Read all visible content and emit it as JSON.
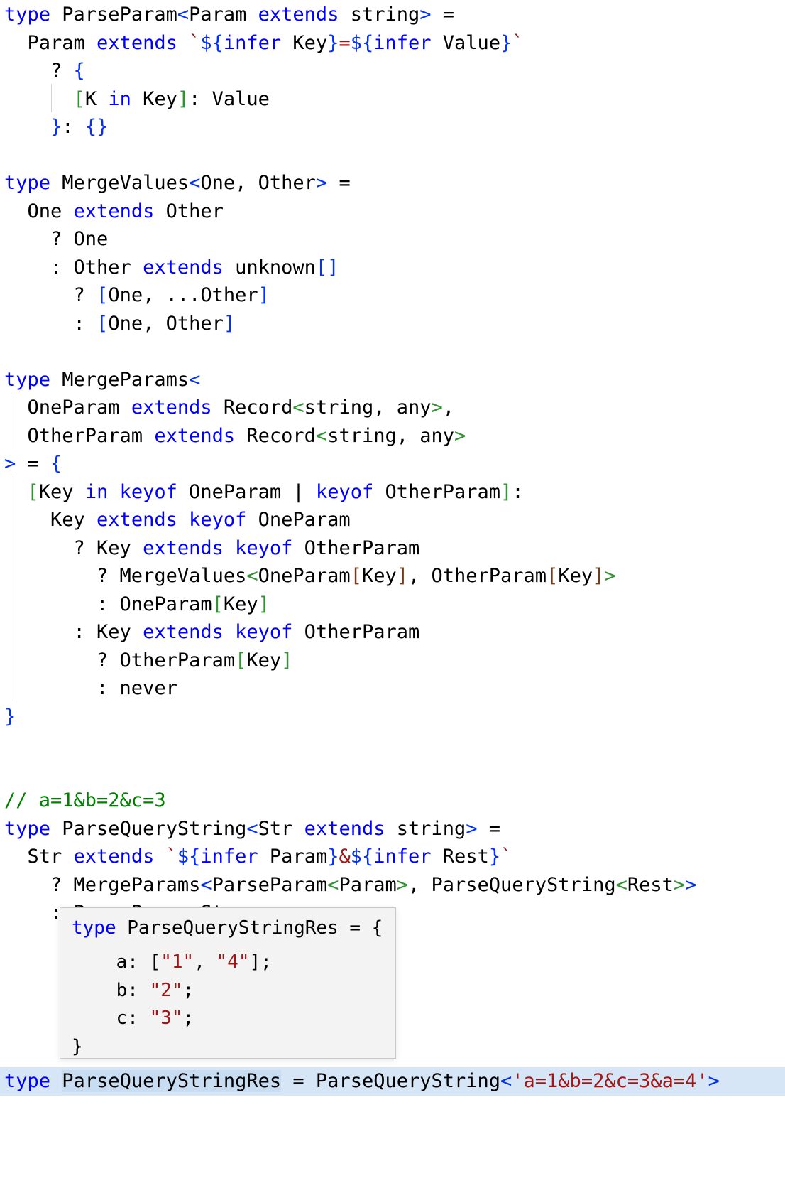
{
  "editor": {
    "language": "typescript",
    "background": "#ffffff",
    "foreground": "#000000",
    "current_line_highlight": "#d7e6f7",
    "colors": {
      "keyword": "#0000ff",
      "identifier": "#000000",
      "string": "#a31515",
      "comment": "#008000",
      "bracket_level_1": "#0431fa",
      "bracket_level_2": "#319331",
      "bracket_level_3": "#7b3814",
      "indent_guide": "#d3d3d3",
      "word_highlight": "#c8ddf2"
    }
  },
  "code": {
    "l01": {
      "t1": "type",
      "t2": " ParseParam",
      "t3": "<",
      "t4": "Param ",
      "t5": "extends",
      "t6": " string",
      "t7": ">",
      "t8": " ="
    },
    "l02": {
      "t1": "  Param ",
      "t2": "extends",
      "t3": " ",
      "t4": "`",
      "t5": "${",
      "t6": "infer",
      "t7": " Key",
      "t8": "}",
      "t9": "=",
      "t10": "${",
      "t11": "infer",
      "t12": " Value",
      "t13": "}",
      "t14": "`"
    },
    "l03": {
      "t1": "    ? ",
      "t2": "{"
    },
    "l04": {
      "t1": "      ",
      "t2": "[",
      "t3": "K ",
      "t4": "in",
      "t5": " Key",
      "t6": "]",
      "t7": ": Value"
    },
    "l05": {
      "t1": "    ",
      "t2": "}",
      "t3": ": ",
      "t4": "{}"
    },
    "l06": "",
    "l07": {
      "t1": "type",
      "t2": " MergeValues",
      "t3": "<",
      "t4": "One, Other",
      "t5": ">",
      "t6": " ="
    },
    "l08": {
      "t1": "  One ",
      "t2": "extends",
      "t3": " Other"
    },
    "l09": {
      "t1": "    ? One"
    },
    "l10": {
      "t1": "    : Other ",
      "t2": "extends",
      "t3": " unknown",
      "t4": "[]"
    },
    "l11": {
      "t1": "      ? ",
      "t2": "[",
      "t3": "One, ...Other",
      "t4": "]"
    },
    "l12": {
      "t1": "      : ",
      "t2": "[",
      "t3": "One, Other",
      "t4": "]"
    },
    "l13": "",
    "l14": {
      "t1": "type",
      "t2": " MergeParams",
      "t3": "<"
    },
    "l15": {
      "t1": "  OneParam ",
      "t2": "extends",
      "t3": " Record",
      "t4": "<",
      "t5": "string, any",
      "t6": ">",
      "t7": ","
    },
    "l16": {
      "t1": "  OtherParam ",
      "t2": "extends",
      "t3": " Record",
      "t4": "<",
      "t5": "string, any",
      "t6": ">"
    },
    "l17": {
      "t1": ">",
      "t2": " = ",
      "t3": "{"
    },
    "l18": {
      "t1": "  ",
      "t2": "[",
      "t3": "Key ",
      "t4": "in",
      "t5": " ",
      "t6": "keyof",
      "t7": " OneParam | ",
      "t8": "keyof",
      "t9": " OtherParam",
      "t10": "]",
      "t11": ":"
    },
    "l19": {
      "t1": "    Key ",
      "t2": "extends",
      "t3": " ",
      "t4": "keyof",
      "t5": " OneParam"
    },
    "l20": {
      "t1": "      ? Key ",
      "t2": "extends",
      "t3": " ",
      "t4": "keyof",
      "t5": " OtherParam"
    },
    "l21": {
      "t1": "        ? MergeValues",
      "t2": "<",
      "t3": "OneParam",
      "t4": "[",
      "t5": "Key",
      "t6": "]",
      "t7": ", OtherParam",
      "t8": "[",
      "t9": "Key",
      "t10": "]",
      "t11": ">"
    },
    "l22": {
      "t1": "        : OneParam",
      "t2": "[",
      "t3": "Key",
      "t4": "]"
    },
    "l23": {
      "t1": "      : Key ",
      "t2": "extends",
      "t3": " ",
      "t4": "keyof",
      "t5": " OtherParam"
    },
    "l24": {
      "t1": "        ? OtherParam",
      "t2": "[",
      "t3": "Key",
      "t4": "]"
    },
    "l25": {
      "t1": "        : never"
    },
    "l26": {
      "t1": "}"
    },
    "l27": "",
    "l28": "",
    "l29": {
      "t1": "// a=1&b=2&c=3"
    },
    "l30": {
      "t1": "type",
      "t2": " ParseQueryString",
      "t3": "<",
      "t4": "Str ",
      "t5": "extends",
      "t6": " string",
      "t7": ">",
      "t8": " ="
    },
    "l31": {
      "t1": "  Str ",
      "t2": "extends",
      "t3": " ",
      "t4": "`",
      "t5": "${",
      "t6": "infer",
      "t7": " Param",
      "t8": "}",
      "t9": "&",
      "t10": "${",
      "t11": "infer",
      "t12": " Rest",
      "t13": "}",
      "t14": "`"
    },
    "l32": {
      "t1": "    ? MergeParams",
      "t2": "<",
      "t3": "ParseParam",
      "t4": "<",
      "t5": "Param",
      "t6": ">",
      "t7": ", ParseQueryString",
      "t8": "<",
      "t9": "Rest",
      "t10": ">",
      "t11": ">"
    },
    "l33": {
      "t1": "    : ParseParam",
      "t2": "<",
      "t3": "Str",
      "t4": ">"
    },
    "l34": "",
    "l35": "",
    "l36": "",
    "l37": "",
    "l38": "",
    "l39": {
      "t1": "type",
      "t2": " ",
      "t3": "ParseQueryStringRes",
      "t4": " = ParseQueryString",
      "t5": "<",
      "t6": "'a=1&b=2&c=3&a=4'",
      "t7": ">"
    }
  },
  "hover_tooltip": {
    "visible": true,
    "background": "#f3f3f3",
    "border_color": "#c8c8c8",
    "lines": {
      "h1": {
        "t1": "type",
        "t2": " ParseQueryStringRes = {"
      },
      "h2": {
        "t1": "    a: [",
        "t2": "\"1\"",
        "t3": ", ",
        "t4": "\"4\"",
        "t5": "];"
      },
      "h3": {
        "t1": "    b: ",
        "t2": "\"2\"",
        "t3": ";"
      },
      "h4": {
        "t1": "    c: ",
        "t2": "\"3\"",
        "t3": ";"
      },
      "h5": {
        "t1": "}"
      }
    }
  }
}
